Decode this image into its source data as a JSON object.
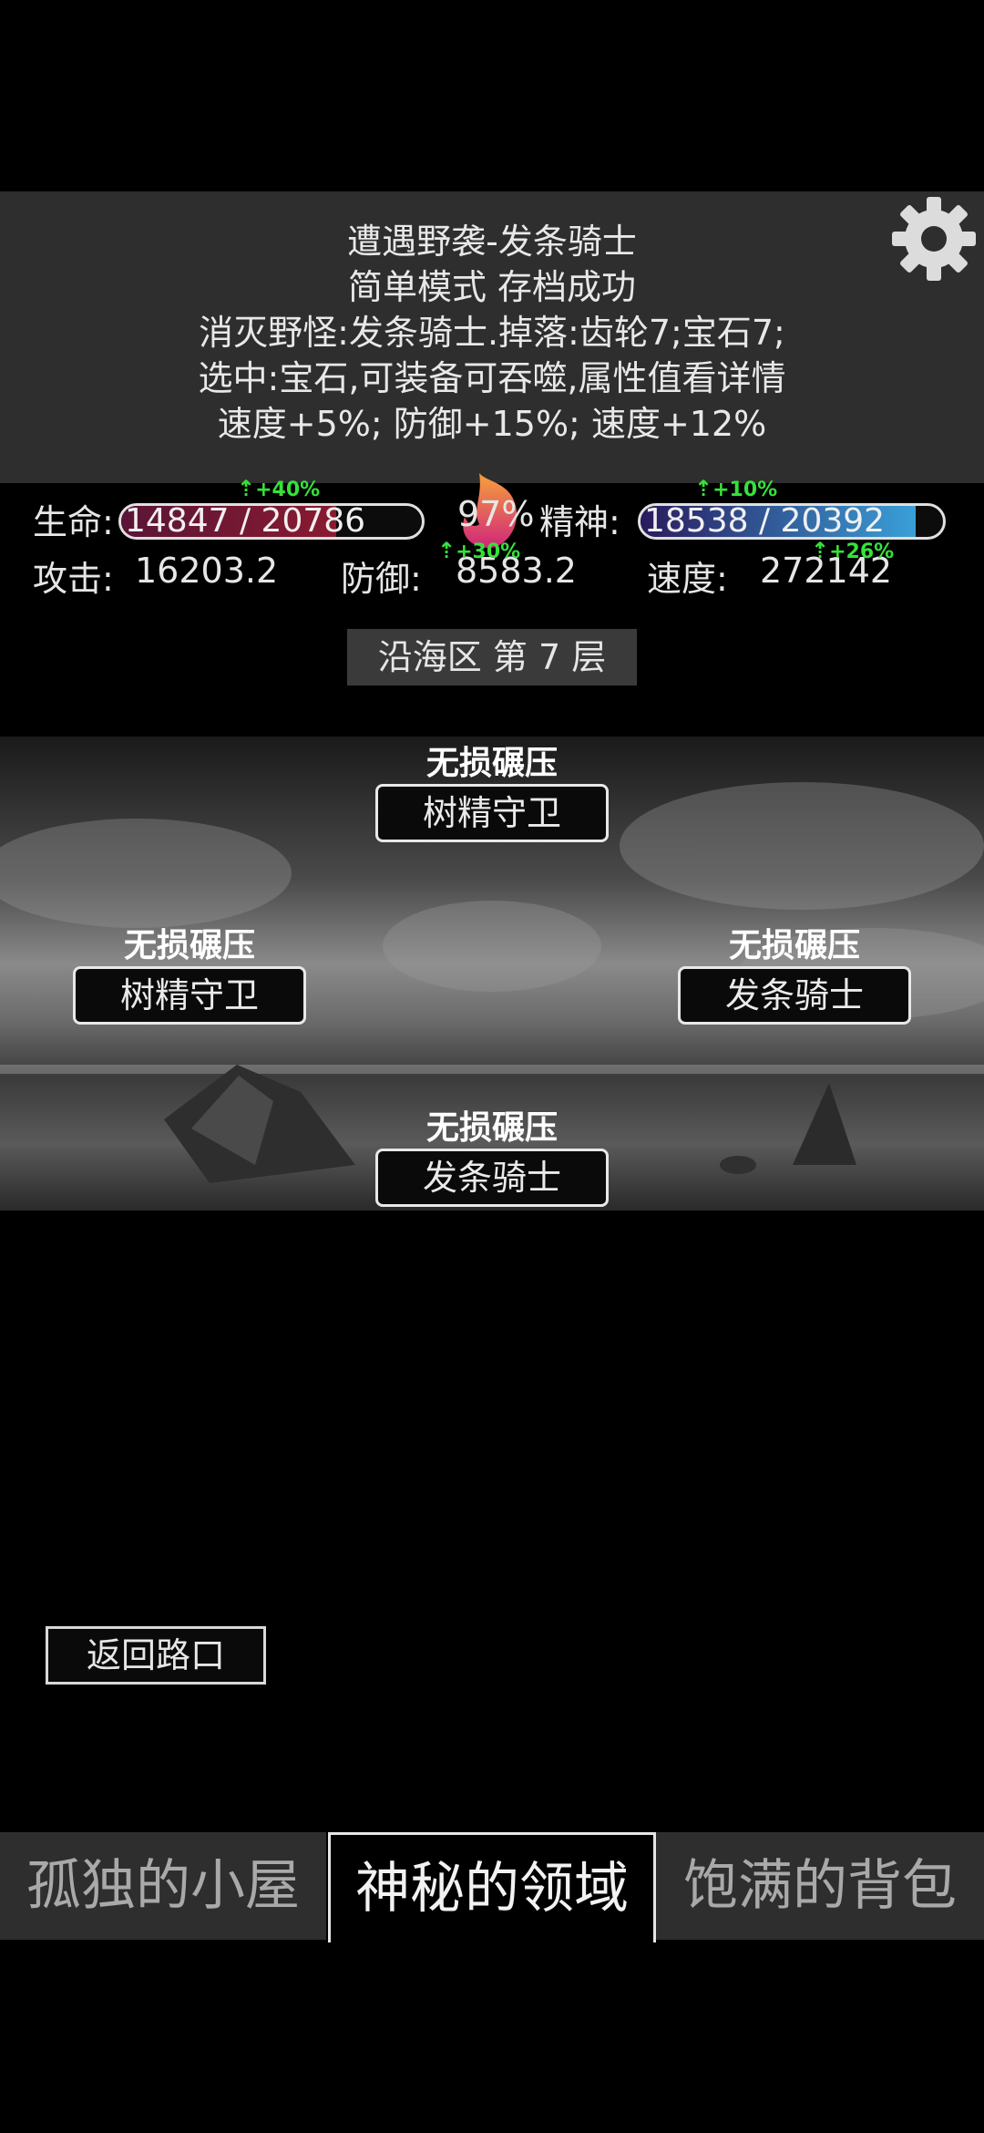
{
  "messages": [
    "遭遇野袭-发条骑士",
    "简单模式 存档成功",
    "消灭野怪:发条骑士.掉落:齿轮7;宝石7;",
    "选中:宝石,可装备可吞噬,属性值看详情",
    "速度+5%; 防御+15%; 速度+12%"
  ],
  "icons": {
    "moon": "moon-icon",
    "settings": "gear-icon",
    "fire": "flame-icon"
  },
  "stats": {
    "hp_label": "生命:",
    "hp_text": "14847 / 20786",
    "hp_fraction": 0.714,
    "hp_buff": "+40%",
    "stamina_percent": "97%",
    "spirit_label": "精神:",
    "spirit_text": "18538 / 20392",
    "spirit_fraction": 0.909,
    "spirit_buff": "+10%",
    "atk_label": "攻击:",
    "atk_value": "16203.2",
    "def_label": "防御:",
    "def_value": "8583.2",
    "def_buff": "+30%",
    "spd_label": "速度:",
    "spd_value": "272142",
    "spd_buff": "+26%"
  },
  "floor": "沿海区 第 7 层",
  "enemies": [
    {
      "tag": "无损碾压",
      "name": "树精守卫"
    },
    {
      "tag": "无损碾压",
      "name": "树精守卫"
    },
    {
      "tag": "无损碾压",
      "name": "发条骑士"
    },
    {
      "tag": "无损碾压",
      "name": "发条骑士"
    }
  ],
  "back_button": "返回路口",
  "tabs": [
    {
      "label": "孤独的小屋",
      "active": false
    },
    {
      "label": "神秘的领域",
      "active": true
    },
    {
      "label": "饱满的背包",
      "active": false
    }
  ],
  "colors": {
    "hp_fill": "#7a1930",
    "spirit_fill_start": "#2a1a5e",
    "spirit_fill_end": "#3aa0d8",
    "buff": "#36e13a"
  }
}
